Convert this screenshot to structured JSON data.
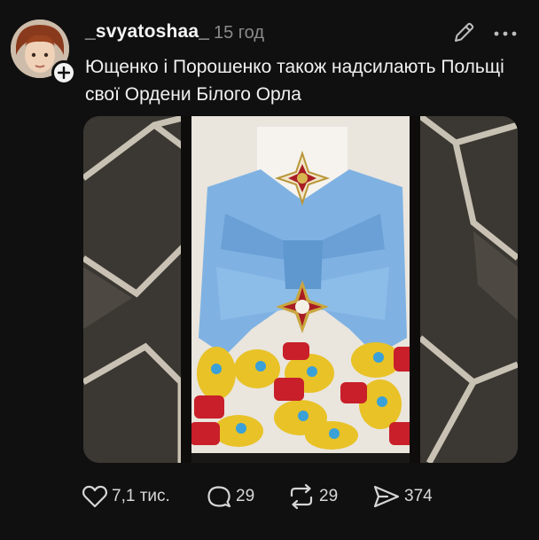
{
  "post": {
    "username": "_svyatoshaa_",
    "timestamp": "15 год",
    "caption": "Ющенко і Порошенко також надсилають Польщі свої Ордени Білого Орла"
  },
  "icons": {
    "follow": "plus-icon",
    "edit": "pencil-icon",
    "more": "more-dots-icon",
    "like": "heart-icon",
    "comment": "comment-icon",
    "repost": "repost-icon",
    "share": "share-icon"
  },
  "actions": {
    "likes": "7,1 тис.",
    "comments": "29",
    "reposts": "29",
    "shares": "374"
  },
  "colors": {
    "background": "#101010",
    "text": "#f2f2f2",
    "muted": "#8a8a8a",
    "ribbon": "#7fb2e3"
  }
}
